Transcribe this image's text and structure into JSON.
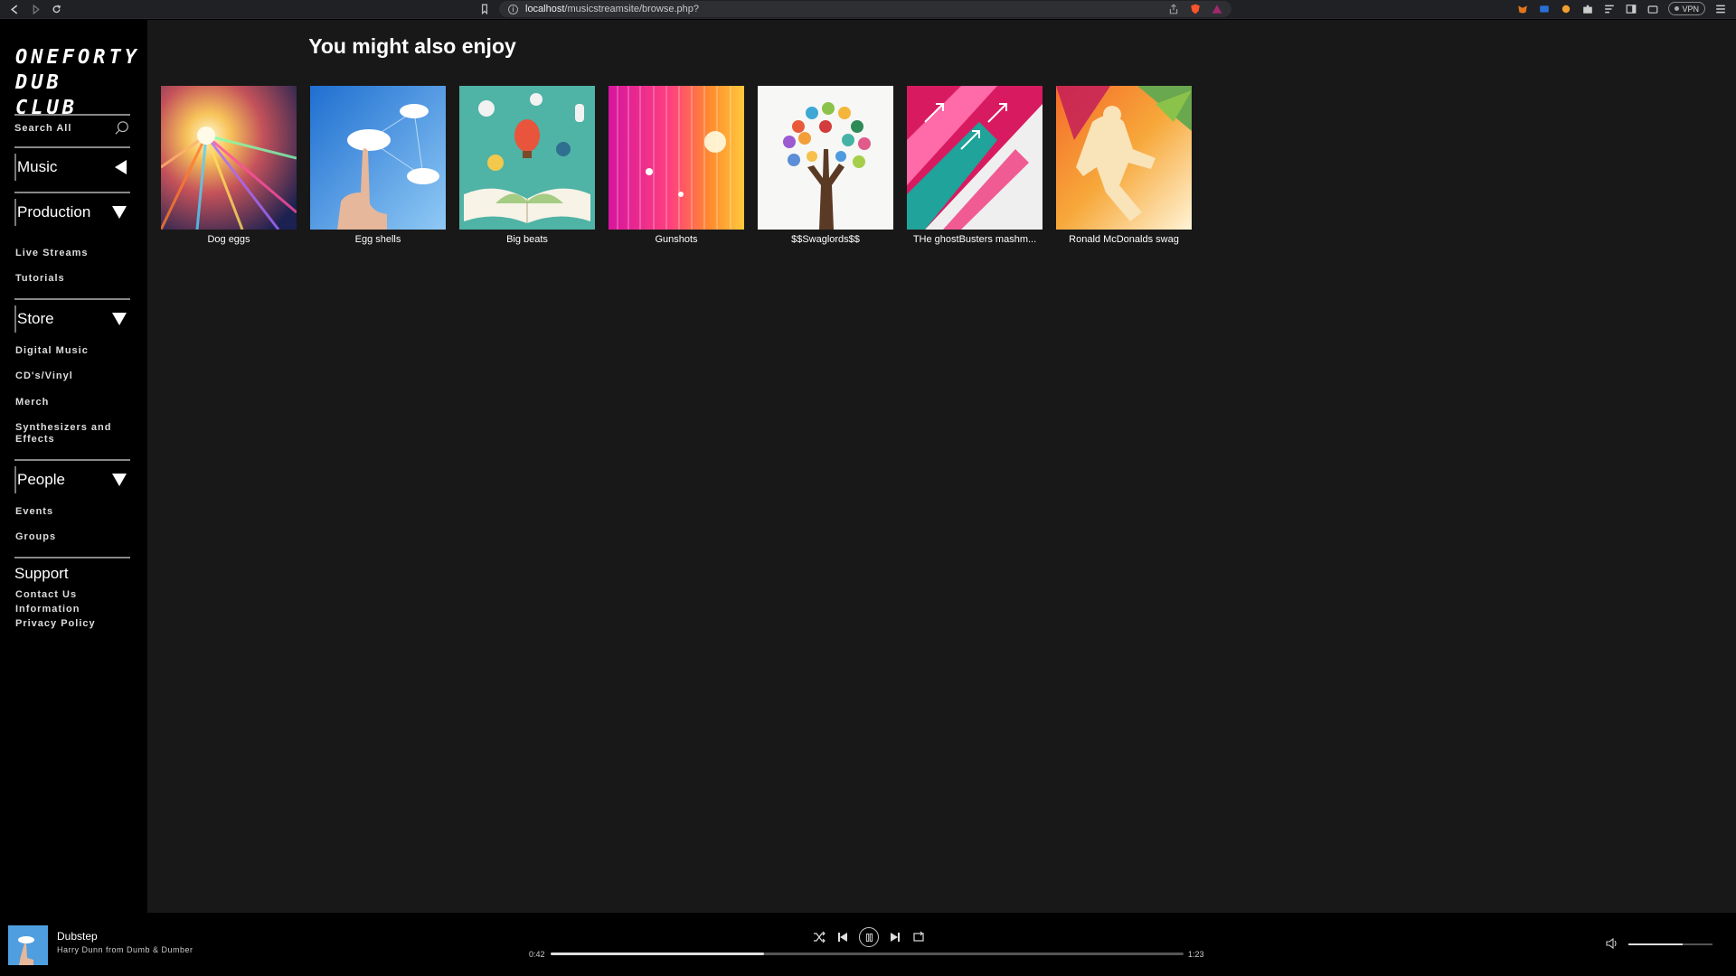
{
  "browser": {
    "url_host": "localhost",
    "url_path": "/musicstreamsite/browse.php?",
    "vpn_label": "VPN"
  },
  "sidebar": {
    "logo_line1": "ONEFORTY",
    "logo_line2": "DUB CLUB",
    "search_label": "Search All",
    "music": {
      "title": "Music"
    },
    "production": {
      "title": "Production",
      "items": [
        "Live Streams",
        "Tutorials"
      ]
    },
    "store": {
      "title": "Store",
      "items": [
        "Digital Music",
        "CD's/Vinyl",
        "Merch",
        "Synthesizers and Effects"
      ]
    },
    "people": {
      "title": "People",
      "items": [
        "Events",
        "Groups"
      ]
    },
    "support": {
      "title": "Support",
      "items": [
        "Contact Us",
        "Information",
        "Privacy Policy"
      ]
    }
  },
  "main": {
    "heading": "You might also enjoy",
    "cards": [
      {
        "title": "Dog eggs"
      },
      {
        "title": "Egg shells"
      },
      {
        "title": "Big beats"
      },
      {
        "title": "Gunshots"
      },
      {
        "title": "$$Swaglords$$"
      },
      {
        "title": "THe ghostBusters mashm..."
      },
      {
        "title": "Ronald McDonalds swag"
      }
    ]
  },
  "player": {
    "track_title": "Dubstep",
    "artist": "Harry Dunn from Dumb & Dumber",
    "elapsed": "0:42",
    "duration": "1:23",
    "progress": 0.337,
    "volume": 0.65
  }
}
